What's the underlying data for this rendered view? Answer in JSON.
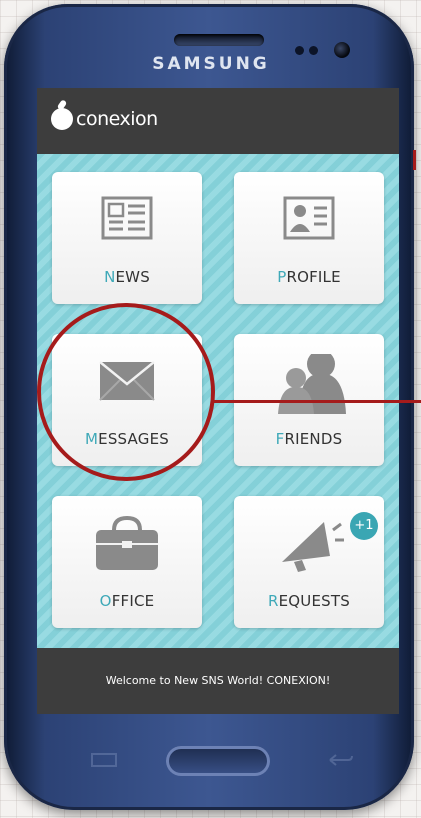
{
  "device": {
    "brand": "SAMSUNG"
  },
  "app": {
    "logo_text": "conexion"
  },
  "tiles": [
    {
      "initial": "N",
      "rest": "EWS",
      "icon": "newspaper-icon"
    },
    {
      "initial": "P",
      "rest": "ROFILE",
      "icon": "id-card-icon"
    },
    {
      "initial": "M",
      "rest": "ESSAGES",
      "icon": "envelope-icon"
    },
    {
      "initial": "F",
      "rest": "RIENDS",
      "icon": "people-icon"
    },
    {
      "initial": "O",
      "rest": "FFICE",
      "icon": "briefcase-icon"
    },
    {
      "initial": "R",
      "rest": "EQUESTS",
      "icon": "megaphone-icon",
      "badge": "+1"
    }
  ],
  "footer": {
    "text": "Welcome to New SNS World! CONEXION!"
  },
  "colors": {
    "accent": "#3fa9b8",
    "badge": "#3aa6b3",
    "background_pattern": "#84d0d8",
    "annotation": "#a51b1b"
  }
}
